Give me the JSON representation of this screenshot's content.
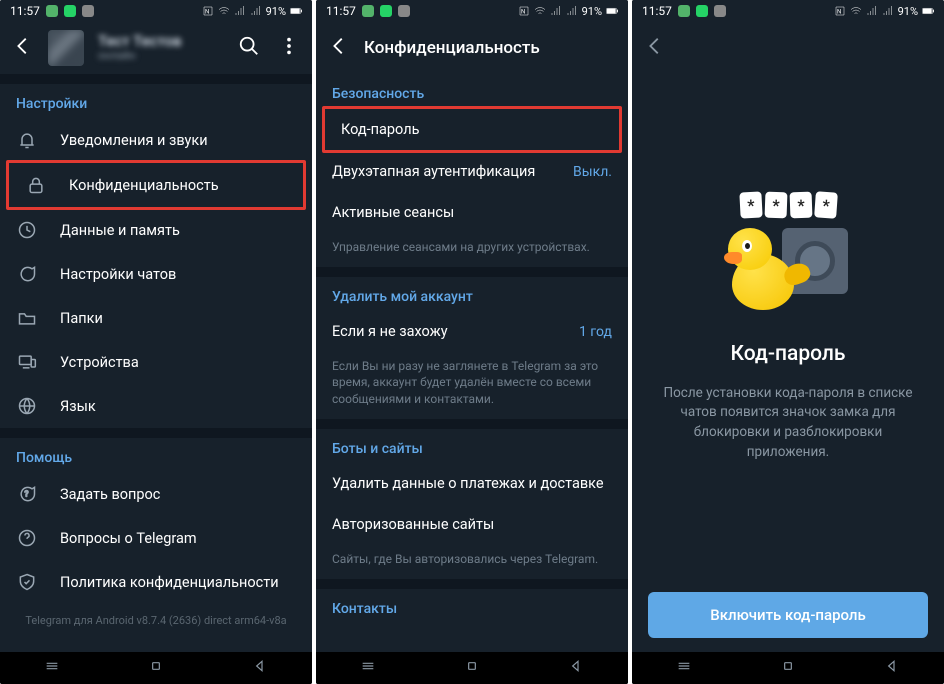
{
  "status": {
    "time": "11:57",
    "battery": "91%"
  },
  "s1": {
    "user_name": "Тест Тестов",
    "user_sub": "онлайн",
    "section_settings": "Настройки",
    "items": [
      {
        "label": "Уведомления и звуки"
      },
      {
        "label": "Конфиденциальность"
      },
      {
        "label": "Данные и память"
      },
      {
        "label": "Настройки чатов"
      },
      {
        "label": "Папки"
      },
      {
        "label": "Устройства"
      },
      {
        "label": "Язык"
      }
    ],
    "section_help": "Помощь",
    "help": [
      {
        "label": "Задать вопрос"
      },
      {
        "label": "Вопросы о Telegram"
      },
      {
        "label": "Политика конфиденциальности"
      }
    ],
    "version": "Telegram для Android v8.7.4 (2636) direct arm64-v8a"
  },
  "s2": {
    "title": "Конфиденциальность",
    "sec_security": "Безопасность",
    "row_passcode": "Код-пароль",
    "row_2fa": "Двухэтапная аутентификация",
    "row_2fa_val": "Выкл.",
    "row_sessions": "Активные сеансы",
    "hint_sessions": "Управление сеансами на других устройствах.",
    "sec_delete": "Удалить мой аккаунт",
    "row_away": "Если я не захожу",
    "row_away_val": "1 год",
    "hint_delete": "Если Вы ни разу не заглянете в Telegram за это время, аккаунт будет удалён вместе со всеми сообщениями и контактами.",
    "sec_bots": "Боты и сайты",
    "row_payments": "Удалить данные о платежах и доставке",
    "row_auth": "Авторизованные сайты",
    "hint_auth": "Сайты, где Вы авторизовались через Telegram.",
    "sec_contacts": "Контакты"
  },
  "s3": {
    "pin": [
      "*",
      "*",
      "*",
      "*"
    ],
    "title": "Код-пароль",
    "text": "После установки кода-пароля в списке чатов появится значок замка для блокировки и разблокировки приложения.",
    "button": "Включить код-пароль"
  }
}
